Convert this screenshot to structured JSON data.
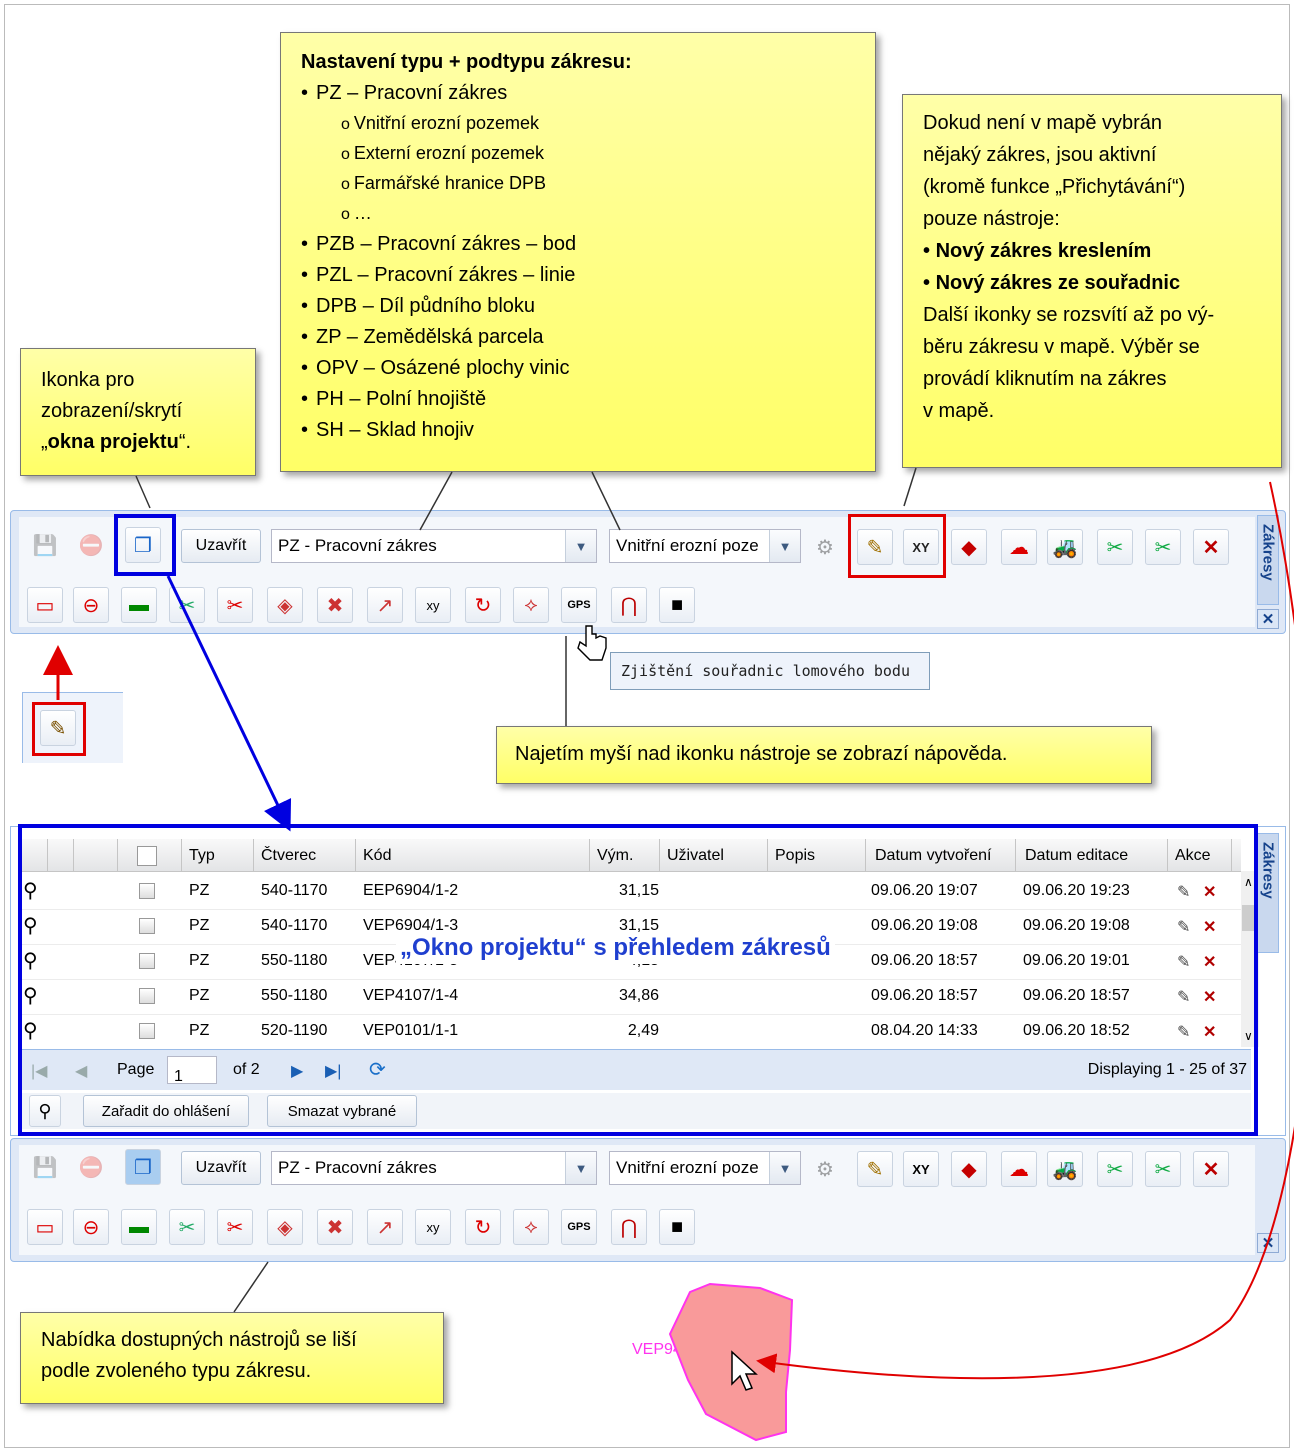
{
  "notes": {
    "type_setting": {
      "heading": "Nastavení typu + podtypu zákresu:",
      "items": [
        {
          "text": "PZ – Pracovní zákres",
          "level": 1
        },
        {
          "text": "Vnitřní erozní pozemek",
          "level": 2
        },
        {
          "text": "Externí erozní pozemek",
          "level": 2
        },
        {
          "text": "Farmářské hranice DPB",
          "level": 2
        },
        {
          "text": "…",
          "level": 2
        },
        {
          "text": "PZB – Pracovní zákres – bod",
          "level": 1
        },
        {
          "text": "PZL – Pracovní zákres – linie",
          "level": 1
        },
        {
          "text": "DPB – Díl půdního bloku",
          "level": 1
        },
        {
          "text": "ZP – Zemědělská parcela",
          "level": 1
        },
        {
          "text": "OPV – Osázené plochy vinic",
          "level": 1
        },
        {
          "text": "PH – Polní hnojiště",
          "level": 1
        },
        {
          "text": "SH – Sklad hnojiv",
          "level": 1
        }
      ]
    },
    "project_icon": {
      "line1": "Ikonka pro",
      "line2": "zobrazení/skrytí",
      "line3_pre": "„",
      "line3_bold": "okna projektu",
      "line3_post": "“."
    },
    "active_tools": {
      "p1": "Dokud není v mapě vybrán",
      "p2": "nějaký zákres, jsou aktivní",
      "p3": "(kromě funkce „Přichytávání“)",
      "p4": "pouze nástroje:",
      "b1": "Nový zákres kreslením",
      "b2": "Nový zákres ze souřadnic",
      "p5": "Další ikonky se rozsvítí až po vý-",
      "p6": "běru zákresu v mapě. Výběr se",
      "p7": "provádí kliknutím na zákres",
      "p8": "v mapě."
    },
    "hover_help": "Najetím myší nad ikonku nástroje se zobrazí nápověda.",
    "tools_vary": {
      "line1": "Nabídka dostupných nástrojů se liší",
      "line2": "podle zvoleného typu zákresu."
    }
  },
  "toolbar": {
    "close_label": "Uzavřít",
    "type_value": "PZ - Pracovní zákres",
    "subtype_value": "Vnitřní erozní poze",
    "side_tab": "Zákresy",
    "close_icon": "✕"
  },
  "tooltip": "Zjištění souřadnic lomového bodu",
  "grid": {
    "overlay_title": "„Okno projektu“ s přehledem zákresů",
    "side_tab": "Zákresy",
    "columns": [
      "Typ",
      "Čtverec",
      "Kód",
      "Vým.",
      "Uživatel",
      "Popis",
      "Datum vytvoření",
      "Datum editace",
      "Akce"
    ],
    "rows": [
      {
        "typ": "PZ",
        "ctverec": "540-1170",
        "kod": "EEP6904/1-2",
        "vym": "31,15",
        "uzivatel": "",
        "popis": "",
        "vytvoreni": "09.06.20 19:07",
        "editace": "09.06.20 19:23"
      },
      {
        "typ": "PZ",
        "ctverec": "540-1170",
        "kod": "VEP6904/1-3",
        "vym": "31,15",
        "uzivatel": "",
        "popis": "",
        "vytvoreni": "09.06.20 19:08",
        "editace": "09.06.20 19:08"
      },
      {
        "typ": "PZ",
        "ctverec": "550-1180",
        "kod": "VEP4107/1-5",
        "vym": "4,15",
        "uzivatel": "",
        "popis": "",
        "vytvoreni": "09.06.20 18:57",
        "editace": "09.06.20 19:01"
      },
      {
        "typ": "PZ",
        "ctverec": "550-1180",
        "kod": "VEP4107/1-4",
        "vym": "34,86",
        "uzivatel": "",
        "popis": "",
        "vytvoreni": "09.06.20 18:57",
        "editace": "09.06.20 18:57"
      },
      {
        "typ": "PZ",
        "ctverec": "520-1190",
        "kod": "VEP0101/1-1",
        "vym": "2,49",
        "uzivatel": "",
        "popis": "",
        "vytvoreni": "08.04.20 14:33",
        "editace": "09.06.20 18:52"
      }
    ],
    "pager": {
      "page_label": "Page",
      "page_value": "1",
      "of_label": "of 2",
      "displaying": "Displaying 1 - 25 of 37"
    },
    "buttons": {
      "add_to_report": "Zařadit do ohlášení",
      "delete_selected": "Smazat vybrané"
    }
  },
  "map": {
    "parcel_label": "VEP9401/5-1"
  },
  "colors": {
    "note_yellow": "#ffff66",
    "highlight_red": "#e00000",
    "highlight_blue": "#0000e0",
    "parcel_fill": "#f99a9a",
    "parcel_stroke": "#ff33ee"
  }
}
